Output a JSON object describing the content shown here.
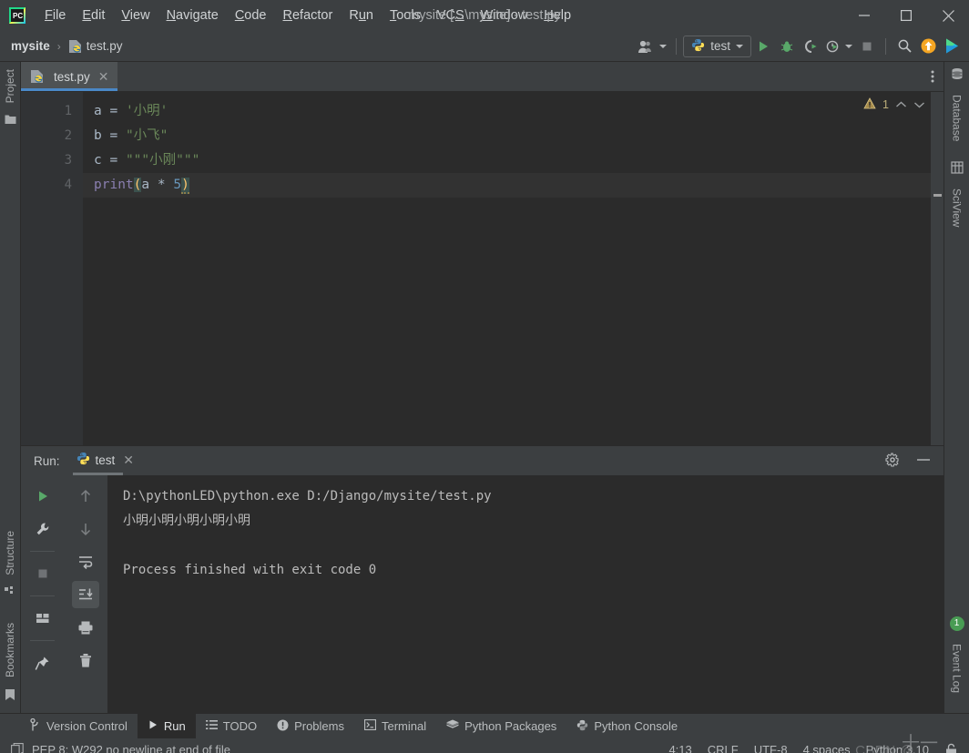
{
  "window": {
    "title": "mysite [...\\mysite] - test.py",
    "minimize": "—",
    "maximize": "□",
    "close": "✕"
  },
  "menu": {
    "items": [
      {
        "label": "File",
        "mnemonic": "F"
      },
      {
        "label": "Edit",
        "mnemonic": "E"
      },
      {
        "label": "View",
        "mnemonic": "V"
      },
      {
        "label": "Navigate",
        "mnemonic": "N"
      },
      {
        "label": "Code",
        "mnemonic": "C"
      },
      {
        "label": "Refactor",
        "mnemonic": "R"
      },
      {
        "label": "Run",
        "mnemonic": "u"
      },
      {
        "label": "Tools",
        "mnemonic": "T"
      },
      {
        "label": "VCS",
        "mnemonic": "S"
      },
      {
        "label": "Window",
        "mnemonic": "W"
      },
      {
        "label": "Help",
        "mnemonic": "H"
      }
    ]
  },
  "navbar": {
    "project": "mysite",
    "separator": "›",
    "file": "test.py",
    "run_config": "test",
    "icons": {
      "user": "user-icon",
      "run": "run-icon",
      "debug": "debug-icon",
      "coverage": "run-coverage-icon",
      "profile": "profile-icon",
      "stop": "stop-icon",
      "search": "search-icon",
      "update": "update-project-icon",
      "ide_assistant": "ide-assistant-icon"
    }
  },
  "left_strip": {
    "top": [
      {
        "label": "Project",
        "icon": "folder-icon"
      }
    ],
    "bottom": [
      {
        "label": "Structure",
        "icon": "structure-icon"
      },
      {
        "label": "Bookmarks",
        "icon": "bookmark-icon"
      }
    ]
  },
  "right_strip": {
    "top": [
      {
        "label": "Database",
        "icon": "database-icon"
      },
      {
        "label": "SciView",
        "icon": "sciview-icon"
      }
    ],
    "bottom": [
      {
        "label": "Event Log",
        "icon": "event-log-icon",
        "badge": "1"
      }
    ]
  },
  "editor": {
    "tab": {
      "name": "test.py",
      "icon": "python-file-icon",
      "close": "✕"
    },
    "overflow_menu": "⋮",
    "inspection": {
      "count": "1",
      "icon": "warning-triangle-icon",
      "prev": "⌃",
      "next": "⌄"
    },
    "lines": [
      {
        "no": "1",
        "tokens": [
          {
            "t": "a ",
            "c": "plain"
          },
          {
            "t": "= ",
            "c": "op"
          },
          {
            "t": "'小明'",
            "c": "str"
          }
        ]
      },
      {
        "no": "2",
        "tokens": [
          {
            "t": "b ",
            "c": "plain"
          },
          {
            "t": "= ",
            "c": "op"
          },
          {
            "t": "\"小飞\"",
            "c": "str"
          }
        ]
      },
      {
        "no": "3",
        "tokens": [
          {
            "t": "c ",
            "c": "plain"
          },
          {
            "t": "= ",
            "c": "op"
          },
          {
            "t": "\"\"\"小刚\"\"\"",
            "c": "str"
          }
        ]
      },
      {
        "no": "4",
        "tokens": [
          {
            "t": "print",
            "c": "fn"
          },
          {
            "t": "(",
            "c": "paren"
          },
          {
            "t": "a ",
            "c": "plain"
          },
          {
            "t": "* ",
            "c": "op"
          },
          {
            "t": "5",
            "c": "num"
          },
          {
            "t": ")",
            "c": "paren"
          }
        ]
      }
    ],
    "line3_intention_icon": "lightbulb-icon"
  },
  "run_panel": {
    "label": "Run:",
    "tab": "test",
    "tab_close": "✕",
    "settings_icon": "gear-icon",
    "minimize_icon": "minimize-icon",
    "tools_left": [
      {
        "name": "rerun-icon"
      },
      {
        "name": "wrench-settings-icon"
      },
      {
        "name": "stop-icon"
      },
      {
        "name": "layout-icon"
      },
      {
        "name": "pin-icon"
      }
    ],
    "tools_right": [
      {
        "name": "up-arrow-icon"
      },
      {
        "name": "down-arrow-icon"
      },
      {
        "name": "soft-wrap-icon"
      },
      {
        "name": "scroll-to-end-icon",
        "selected": true
      },
      {
        "name": "print-icon"
      },
      {
        "name": "trash-icon"
      }
    ],
    "console": [
      "D:\\pythonLED\\python.exe D:/Django/mysite/test.py",
      "小明小明小明小明小明",
      "",
      "Process finished with exit code 0"
    ]
  },
  "bottom_bar": {
    "items": [
      {
        "label": "Version Control",
        "icon": "branch-icon",
        "active": false
      },
      {
        "label": "Run",
        "icon": "run-icon",
        "active": true
      },
      {
        "label": "TODO",
        "icon": "todo-list-icon",
        "active": false
      },
      {
        "label": "Problems",
        "icon": "problems-icon",
        "active": false
      },
      {
        "label": "Terminal",
        "icon": "terminal-icon",
        "active": false
      },
      {
        "label": "Python Packages",
        "icon": "packages-icon",
        "active": false
      },
      {
        "label": "Python Console",
        "icon": "python-icon",
        "active": false
      }
    ]
  },
  "status_bar": {
    "message": "PEP 8: W292 no newline at end of file",
    "message_icon": "inspection-copy-icon",
    "caret": "4:13",
    "line_sep": "CRLF",
    "encoding": "UTF-8",
    "indent": "4 spaces",
    "interpreter": "Python 3.10",
    "lock_icon": "lock-icon",
    "watermark": "CSDN @",
    "watermark_plus": "十一"
  },
  "colors": {
    "accent_blue": "#4a88c7",
    "string_green": "#6a8759",
    "number_blue": "#6897bb",
    "function_purple": "#8a7fb0",
    "bg_editor": "#2b2b2b",
    "bg_chrome": "#3c3f41",
    "badge_green": "#499c54",
    "warn_yellow": "#bcae7a"
  }
}
